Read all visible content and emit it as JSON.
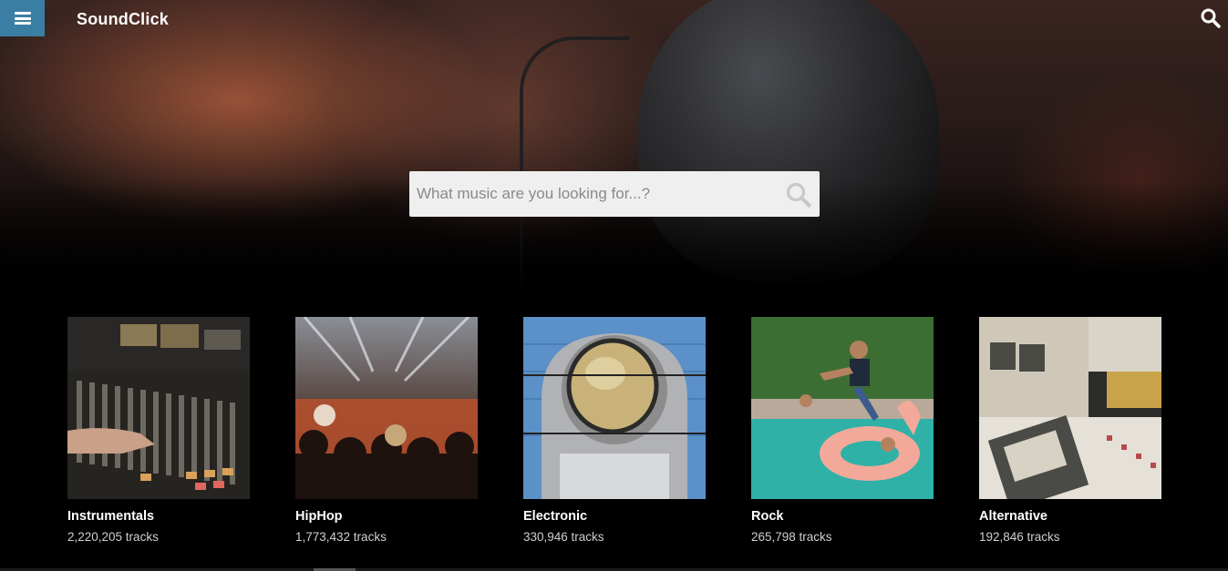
{
  "header": {
    "logo": "SoundClick"
  },
  "search": {
    "placeholder": "What music are you looking for...?"
  },
  "genres": [
    {
      "name": "Instrumentals",
      "count": "2,220,205 tracks"
    },
    {
      "name": "HipHop",
      "count": "1,773,432 tracks"
    },
    {
      "name": "Electronic",
      "count": "330,946 tracks"
    },
    {
      "name": "Rock",
      "count": "265,798 tracks"
    },
    {
      "name": "Alternative",
      "count": "192,846 tracks"
    }
  ],
  "colors": {
    "menu_button": "#3a7fa3",
    "background": "#000000",
    "search_box": "#efefef"
  },
  "icons": {
    "menu": "hamburger-menu-icon",
    "search": "search-icon"
  }
}
